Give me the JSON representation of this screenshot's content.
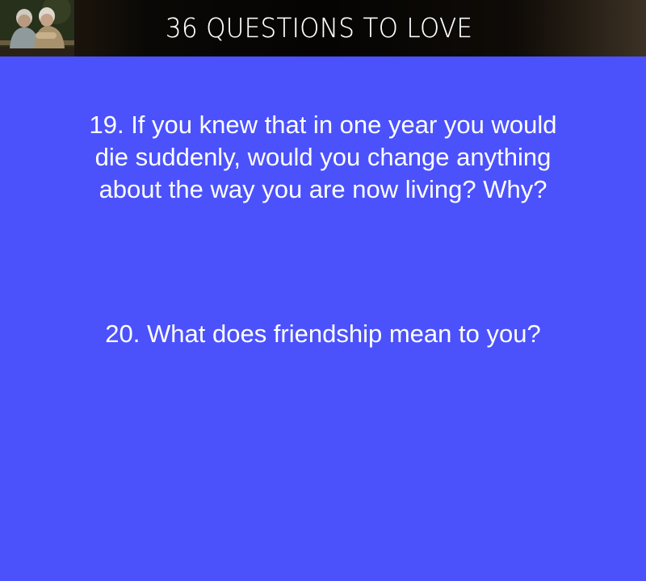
{
  "header": {
    "title": "36 QUESTIONS TO LOVE",
    "image_icon": "elderly-couple-photo"
  },
  "questions": [
    {
      "text": "19. If you knew that in one year you would die suddenly, would you change anything about the way you are now living? Why?"
    },
    {
      "text": "20. What does friendship mean to you?"
    }
  ],
  "colors": {
    "background": "#4b52fc",
    "header_background": "#050403",
    "text": "#ffffff"
  }
}
